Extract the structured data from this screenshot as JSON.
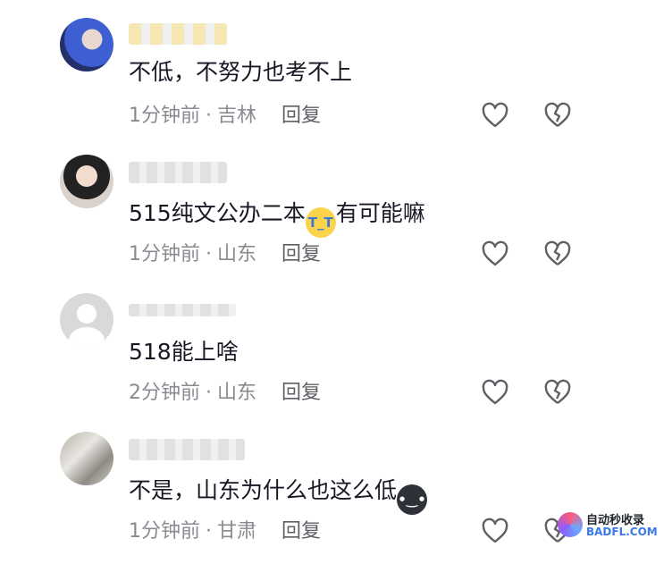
{
  "comments": [
    {
      "text": "不低，不努力也考不上",
      "time": "1分钟前",
      "location": "吉林",
      "reply": "回复",
      "emoji": ""
    },
    {
      "text": "515纯文公办二本",
      "emoji": "loudly-crying-face",
      "text_after": "有可能嘛",
      "time": "1分钟前",
      "location": "山东",
      "reply": "回复"
    },
    {
      "text": "518能上啥",
      "time": "2分钟前",
      "location": "山东",
      "reply": "回复",
      "emoji": ""
    },
    {
      "text": "不是，山东为什么也这么低",
      "emoji": "dark-face",
      "time": "1分钟前",
      "location": "甘肃",
      "reply": "回复"
    }
  ],
  "separator": "·",
  "icons": {
    "like": "heart-outline-icon",
    "dislike": "broken-heart-icon"
  },
  "watermark": {
    "title": "自动秒收录",
    "site": "BADFL.COM"
  },
  "colors": {
    "text": "#161823",
    "meta": "#8a8b91",
    "icon": "#5f6066",
    "watermark_site": "#3a78e8"
  }
}
